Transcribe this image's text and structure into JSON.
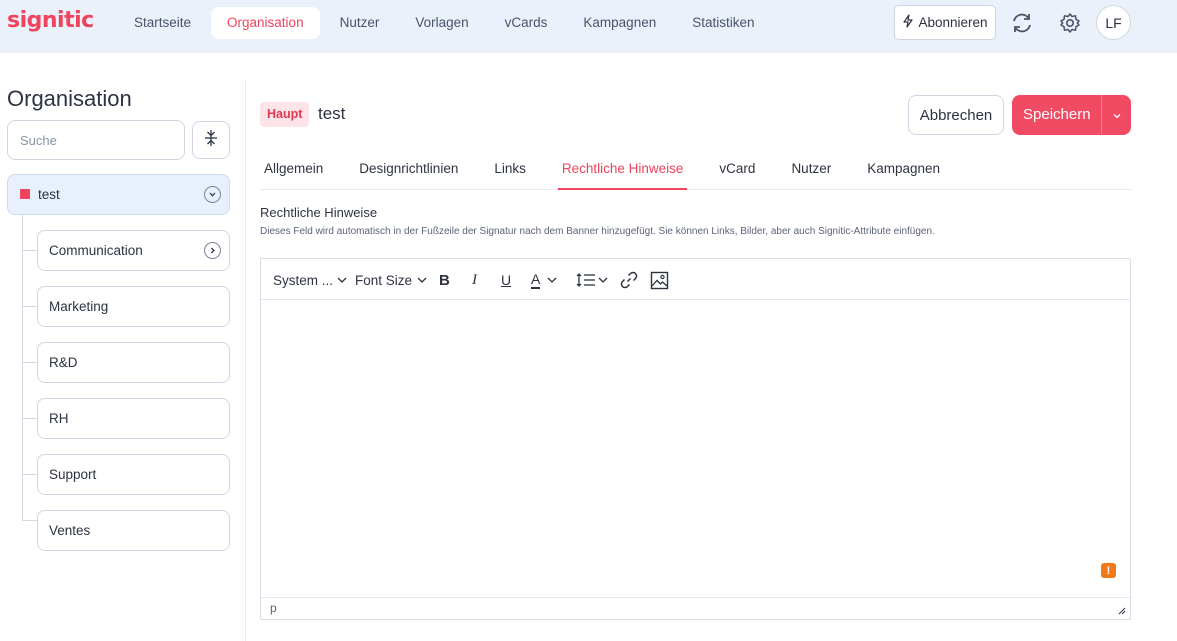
{
  "app": {
    "logo_text": "signitic",
    "brand_color": "#f0445c"
  },
  "nav": {
    "items": [
      {
        "label": "Startseite",
        "active": false
      },
      {
        "label": "Organisation",
        "active": true
      },
      {
        "label": "Nutzer",
        "active": false
      },
      {
        "label": "Vorlagen",
        "active": false
      },
      {
        "label": "vCards",
        "active": false
      },
      {
        "label": "Kampagnen",
        "active": false
      },
      {
        "label": "Statistiken",
        "active": false
      }
    ],
    "subscribe_label": "Abonnieren",
    "subscribe_icon": "lightning-icon",
    "sync_icon": "sync-icon",
    "settings_icon": "gear-icon",
    "avatar_initials": "LF"
  },
  "sidebar": {
    "title": "Organisation",
    "search_placeholder": "Suche",
    "collapse_icon": "collapse-all-icon",
    "root": {
      "label": "test",
      "color": "#f0445c"
    },
    "children": [
      {
        "label": "Communication",
        "has_children": true
      },
      {
        "label": "Marketing",
        "has_children": false
      },
      {
        "label": "R&D",
        "has_children": false
      },
      {
        "label": "RH",
        "has_children": false
      },
      {
        "label": "Support",
        "has_children": false
      },
      {
        "label": "Ventes",
        "has_children": false
      }
    ]
  },
  "main": {
    "badge": "Haupt",
    "org_name": "test",
    "cancel_label": "Abbrechen",
    "save_label": "Speichern",
    "tabs": [
      {
        "label": "Allgemein",
        "active": false
      },
      {
        "label": "Designrichtlinien",
        "active": false
      },
      {
        "label": "Links",
        "active": false
      },
      {
        "label": "Rechtliche Hinweise",
        "active": true
      },
      {
        "label": "vCard",
        "active": false
      },
      {
        "label": "Nutzer",
        "active": false
      },
      {
        "label": "Kampagnen",
        "active": false
      }
    ],
    "section_title": "Rechtliche Hinweise",
    "section_desc": "Dieses Feld wird automatisch in der Fußzeile der Signatur nach dem Banner hinzugefügt. Sie können Links, Bilder, aber auch Signitic-Attribute einfügen.",
    "editor": {
      "font_family": "System ...",
      "font_size": "Font Size",
      "bold": "B",
      "italic": "I",
      "underline": "U",
      "text_color": "A",
      "status_path": "p",
      "warning_mark": "!"
    }
  }
}
